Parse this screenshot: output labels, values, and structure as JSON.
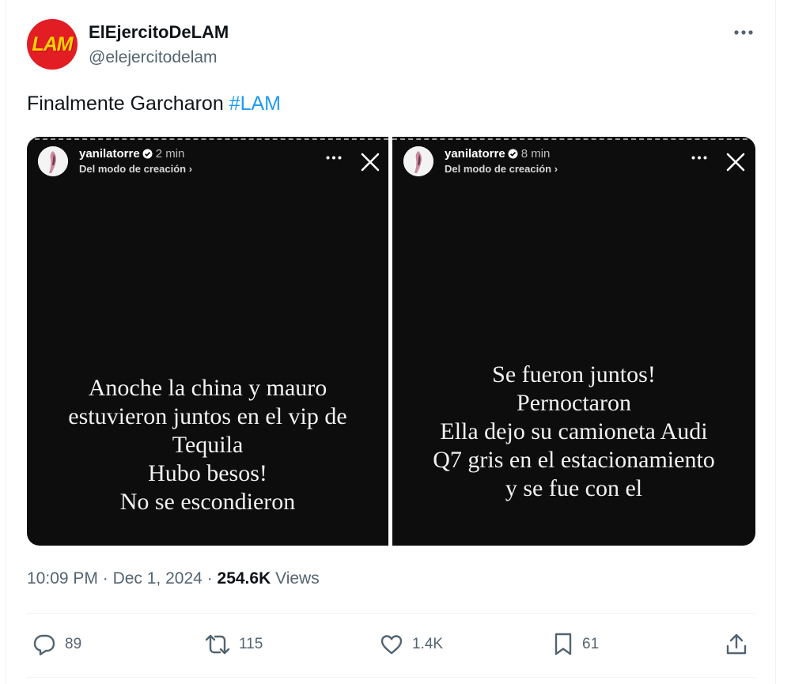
{
  "author": {
    "avatar_text": "LAM",
    "display_name": "ElEjercitoDeLAM",
    "handle": "@elejercitodelam"
  },
  "tweet": {
    "text": "Finalmente Garcharon ",
    "hashtag": "#LAM"
  },
  "stories": [
    {
      "username": "yanilatorre",
      "time": "2 min",
      "subtitle": "Del modo de creación ›",
      "lines": [
        "Anoche la china y mauro",
        "estuvieron juntos en el vip de",
        "Tequila",
        "Hubo besos!",
        "No se escondieron"
      ]
    },
    {
      "username": "yanilatorre",
      "time": "8 min",
      "subtitle": "Del modo de creación ›",
      "lines": [
        "Se fueron juntos!",
        "Pernoctaron",
        "Ella dejo su camioneta Audi",
        "Q7 gris en el estacionamiento",
        "y se fue con el"
      ]
    }
  ],
  "meta": {
    "time": "10:09 PM",
    "separator": "·",
    "date": "Dec 1, 2024",
    "views_count": "254.6K",
    "views_label": "Views"
  },
  "actions": {
    "replies": "89",
    "reposts": "115",
    "likes": "1.4K",
    "bookmarks": "61"
  },
  "colors": {
    "accent": "#1d9bf0",
    "secondary_text": "#536471",
    "brand_red": "#e21d24",
    "brand_yellow": "#ffd200"
  }
}
